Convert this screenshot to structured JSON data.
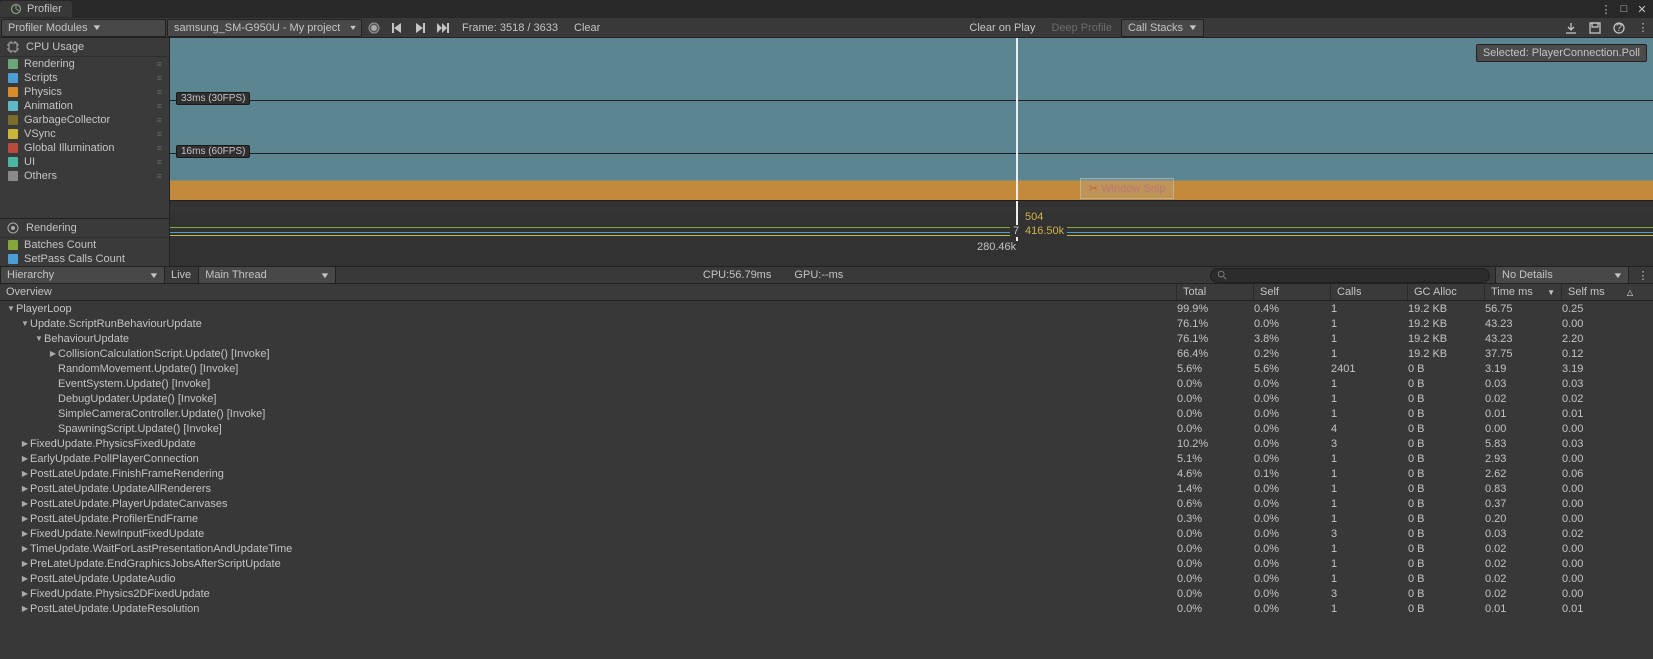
{
  "tab": {
    "title": "Profiler"
  },
  "window": {
    "unlock": "⊽",
    "max": "□",
    "close": "✕",
    "menu": "⋮"
  },
  "toolbar": {
    "modules_dd": "Profiler Modules",
    "target_dd": "samsung_SM-G950U - My project",
    "frame_label": "Frame: 3518 / 3633",
    "clear": "Clear",
    "clear_on_play": "Clear on Play",
    "deep_profile": "Deep Profile",
    "call_stacks": "Call Stacks"
  },
  "cpu_module": {
    "title": "CPU Usage",
    "legend": [
      {
        "label": "Rendering",
        "color": "#6aa87a"
      },
      {
        "label": "Scripts",
        "color": "#4a9fd4"
      },
      {
        "label": "Physics",
        "color": "#d88b2a"
      },
      {
        "label": "Animation",
        "color": "#5fb7c8"
      },
      {
        "label": "GarbageCollector",
        "color": "#7a6c2c"
      },
      {
        "label": "VSync",
        "color": "#c9b738"
      },
      {
        "label": "Global Illumination",
        "color": "#b94a3e"
      },
      {
        "label": "UI",
        "color": "#4ab5a0"
      },
      {
        "label": "Others",
        "color": "#8a8a8a"
      }
    ],
    "line33": "33ms (30FPS)",
    "line16": "16ms (60FPS)",
    "sel_tip": "Selected: PlayerConnection.Poll",
    "snip": "Window Snip"
  },
  "render_module": {
    "title": "Rendering",
    "legend": [
      {
        "label": "Batches Count",
        "color": "#86a83a"
      },
      {
        "label": "SetPass Calls Count",
        "color": "#4a9fd4"
      }
    ],
    "labels": {
      "top": "504",
      "mid": "416.50k",
      "bot": "280.46k",
      "seven": "7"
    }
  },
  "detail": {
    "view_dd": "Hierarchy",
    "live": "Live",
    "thread_dd": "Main Thread",
    "cpu_stat": "CPU:56.79ms",
    "gpu_stat": "GPU:--ms",
    "nodetails": "No Details"
  },
  "columns": [
    "Overview",
    "Total",
    "Self",
    "Calls",
    "GC Alloc",
    "Time ms",
    "Self ms"
  ],
  "rows": [
    {
      "d": 0,
      "a": "down",
      "n": "PlayerLoop",
      "v": [
        "99.9%",
        "0.4%",
        "1",
        "19.2 KB",
        "56.75",
        "0.25"
      ]
    },
    {
      "d": 1,
      "a": "down",
      "n": "Update.ScriptRunBehaviourUpdate",
      "v": [
        "76.1%",
        "0.0%",
        "1",
        "19.2 KB",
        "43.23",
        "0.00"
      ]
    },
    {
      "d": 2,
      "a": "down",
      "n": "BehaviourUpdate",
      "v": [
        "76.1%",
        "3.8%",
        "1",
        "19.2 KB",
        "43.23",
        "2.20"
      ]
    },
    {
      "d": 3,
      "a": "right",
      "n": "CollisionCalculationScript.Update() [Invoke]",
      "v": [
        "66.4%",
        "0.2%",
        "1",
        "19.2 KB",
        "37.75",
        "0.12"
      ]
    },
    {
      "d": 3,
      "a": "",
      "n": "RandomMovement.Update() [Invoke]",
      "v": [
        "5.6%",
        "5.6%",
        "2401",
        "0 B",
        "3.19",
        "3.19"
      ]
    },
    {
      "d": 3,
      "a": "",
      "n": "EventSystem.Update() [Invoke]",
      "v": [
        "0.0%",
        "0.0%",
        "1",
        "0 B",
        "0.03",
        "0.03"
      ]
    },
    {
      "d": 3,
      "a": "",
      "n": "DebugUpdater.Update() [Invoke]",
      "v": [
        "0.0%",
        "0.0%",
        "1",
        "0 B",
        "0.02",
        "0.02"
      ]
    },
    {
      "d": 3,
      "a": "",
      "n": "SimpleCameraController.Update() [Invoke]",
      "v": [
        "0.0%",
        "0.0%",
        "1",
        "0 B",
        "0.01",
        "0.01"
      ]
    },
    {
      "d": 3,
      "a": "",
      "n": "SpawningScript.Update() [Invoke]",
      "v": [
        "0.0%",
        "0.0%",
        "4",
        "0 B",
        "0.00",
        "0.00"
      ]
    },
    {
      "d": 1,
      "a": "right",
      "n": "FixedUpdate.PhysicsFixedUpdate",
      "v": [
        "10.2%",
        "0.0%",
        "3",
        "0 B",
        "5.83",
        "0.03"
      ]
    },
    {
      "d": 1,
      "a": "right",
      "n": "EarlyUpdate.PollPlayerConnection",
      "v": [
        "5.1%",
        "0.0%",
        "1",
        "0 B",
        "2.93",
        "0.00"
      ]
    },
    {
      "d": 1,
      "a": "right",
      "n": "PostLateUpdate.FinishFrameRendering",
      "v": [
        "4.6%",
        "0.1%",
        "1",
        "0 B",
        "2.62",
        "0.06"
      ]
    },
    {
      "d": 1,
      "a": "right",
      "n": "PostLateUpdate.UpdateAllRenderers",
      "v": [
        "1.4%",
        "0.0%",
        "1",
        "0 B",
        "0.83",
        "0.00"
      ]
    },
    {
      "d": 1,
      "a": "right",
      "n": "PostLateUpdate.PlayerUpdateCanvases",
      "v": [
        "0.6%",
        "0.0%",
        "1",
        "0 B",
        "0.37",
        "0.00"
      ]
    },
    {
      "d": 1,
      "a": "right",
      "n": "PostLateUpdate.ProfilerEndFrame",
      "v": [
        "0.3%",
        "0.0%",
        "1",
        "0 B",
        "0.20",
        "0.00"
      ]
    },
    {
      "d": 1,
      "a": "right",
      "n": "FixedUpdate.NewInputFixedUpdate",
      "v": [
        "0.0%",
        "0.0%",
        "3",
        "0 B",
        "0.03",
        "0.02"
      ]
    },
    {
      "d": 1,
      "a": "right",
      "n": "TimeUpdate.WaitForLastPresentationAndUpdateTime",
      "v": [
        "0.0%",
        "0.0%",
        "1",
        "0 B",
        "0.02",
        "0.00"
      ]
    },
    {
      "d": 1,
      "a": "right",
      "n": "PreLateUpdate.EndGraphicsJobsAfterScriptUpdate",
      "v": [
        "0.0%",
        "0.0%",
        "1",
        "0 B",
        "0.02",
        "0.00"
      ]
    },
    {
      "d": 1,
      "a": "right",
      "n": "PostLateUpdate.UpdateAudio",
      "v": [
        "0.0%",
        "0.0%",
        "1",
        "0 B",
        "0.02",
        "0.00"
      ]
    },
    {
      "d": 1,
      "a": "right",
      "n": "FixedUpdate.Physics2DFixedUpdate",
      "v": [
        "0.0%",
        "0.0%",
        "3",
        "0 B",
        "0.02",
        "0.00"
      ]
    },
    {
      "d": 1,
      "a": "right",
      "n": "PostLateUpdate.UpdateResolution",
      "v": [
        "0.0%",
        "0.0%",
        "1",
        "0 B",
        "0.01",
        "0.01"
      ]
    }
  ],
  "colors": {
    "accent": "#d88b2a"
  }
}
